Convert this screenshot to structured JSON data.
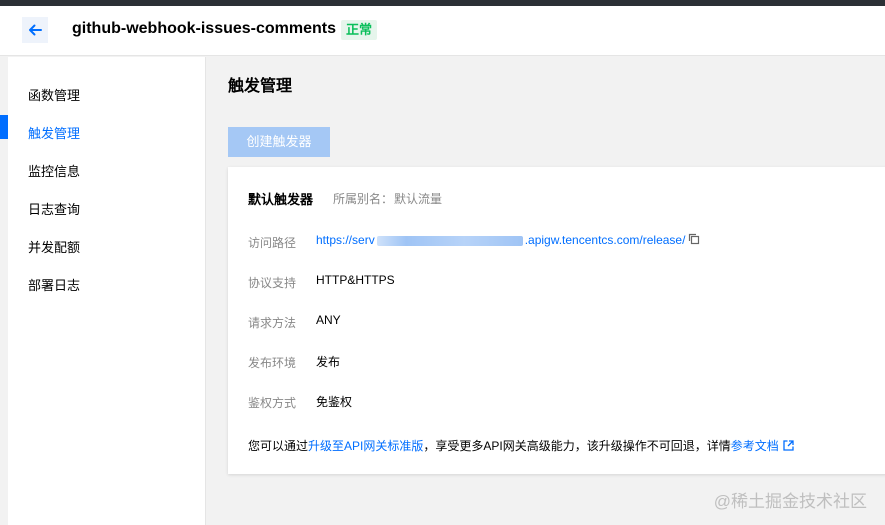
{
  "header": {
    "function_name": "github-webhook-issues-comments",
    "status": "正常",
    "back_icon": "arrow-left-icon"
  },
  "sidebar": {
    "items": [
      {
        "label": "函数管理",
        "active": false
      },
      {
        "label": "触发管理",
        "active": true
      },
      {
        "label": "监控信息",
        "active": false
      },
      {
        "label": "日志查询",
        "active": false
      },
      {
        "label": "并发配额",
        "active": false
      },
      {
        "label": "部署日志",
        "active": false
      }
    ]
  },
  "main": {
    "title": "触发管理",
    "create_button": "创建触发器",
    "trigger": {
      "title": "默认触发器",
      "alias_label": "所属别名：",
      "alias_value": "默认流量",
      "rows": [
        {
          "label": "访问路径",
          "url_prefix": "https://serv",
          "url_suffix": ".apigw.tencentcs.com/release/"
        },
        {
          "label": "协议支持",
          "value": "HTTP&HTTPS"
        },
        {
          "label": "请求方法",
          "value": "ANY"
        },
        {
          "label": "发布环境",
          "value": "发布"
        },
        {
          "label": "鉴权方式",
          "value": "免鉴权"
        }
      ],
      "notice": {
        "text_before": "您可以通过",
        "link1": "升级至API网关标准版",
        "text_middle": "，享受更多API网关高级能力，该升级操作不可回退，详情",
        "link2": "参考文档"
      }
    }
  },
  "watermark": "@稀土掘金技术社区",
  "colors": {
    "accent": "#006eff",
    "status_green": "#0abf5b",
    "disabled_button": "#a5c8f5"
  }
}
